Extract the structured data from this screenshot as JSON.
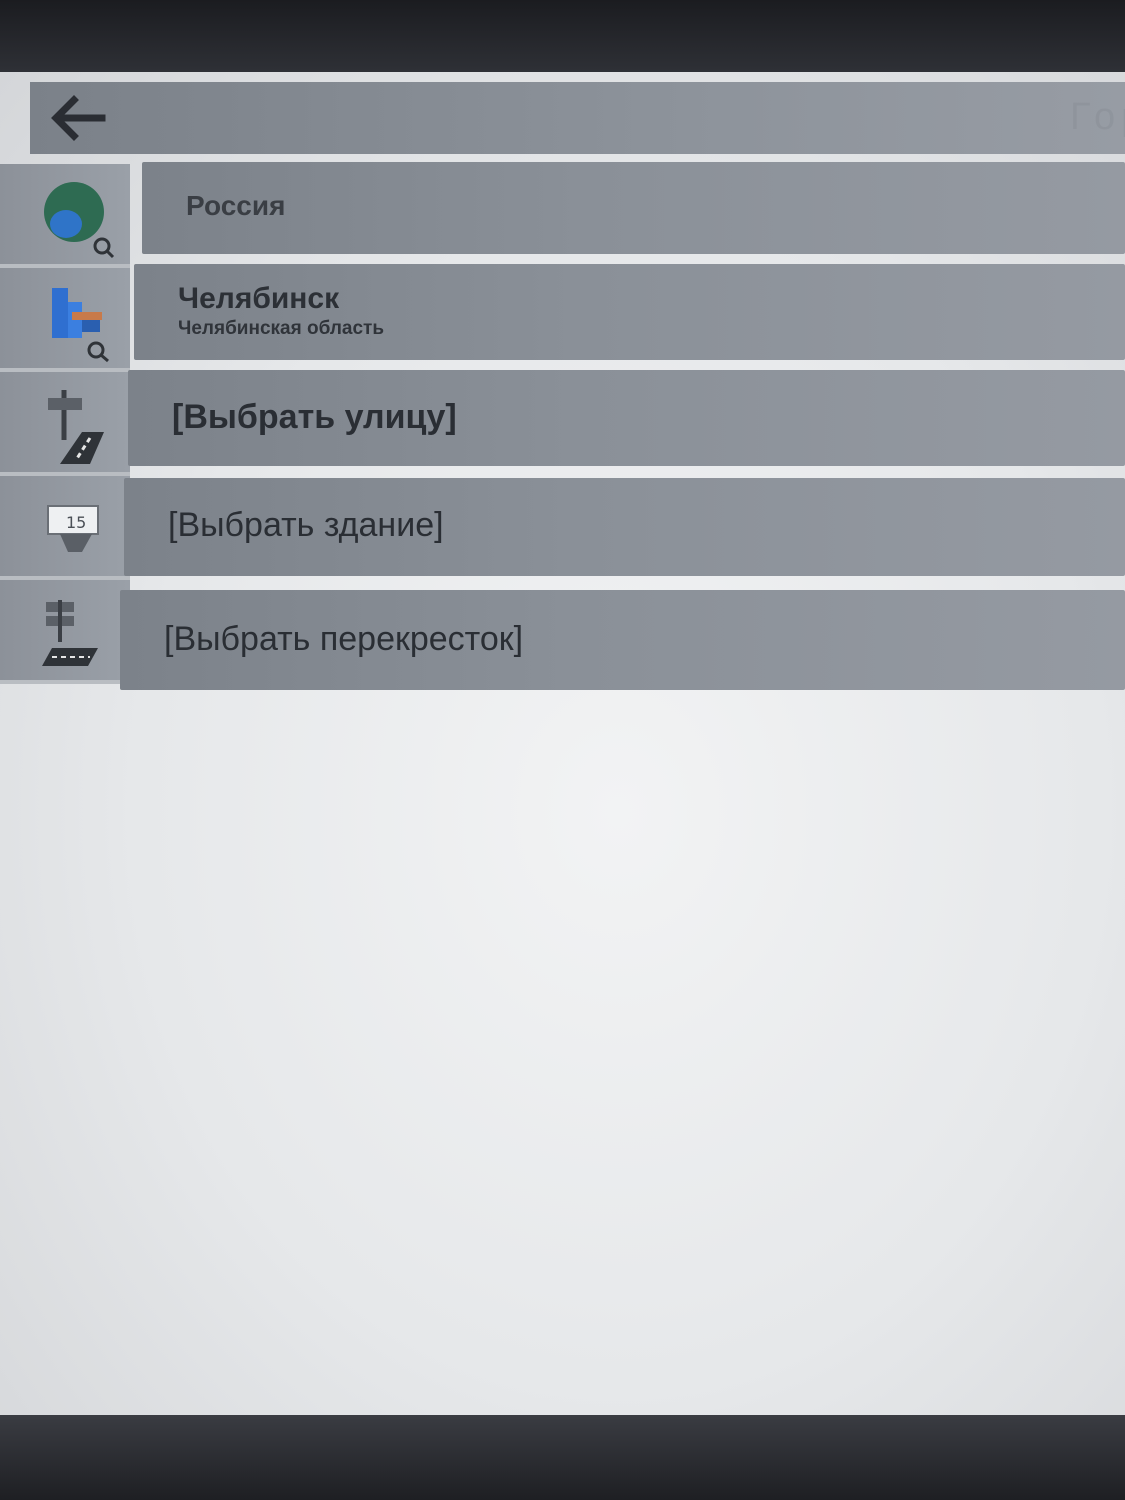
{
  "header": {
    "title": "Гор",
    "back_icon": "arrow-left-icon"
  },
  "rows": [
    {
      "icon": "globe-search-icon",
      "title": "Россия"
    },
    {
      "icon": "city-search-icon",
      "title": "Челябинск",
      "subtitle": "Челябинская область"
    },
    {
      "icon": "street-sign-icon",
      "title": "[Выбрать улицу]"
    },
    {
      "icon": "building-number-icon",
      "title": "[Выбрать здание]"
    },
    {
      "icon": "intersection-icon",
      "title": "[Выбрать перекресток]"
    }
  ],
  "colors": {
    "header_bg": "#8a9098",
    "row_bg": "#8a9098",
    "screen_bg": "#e6e8ea",
    "text": "#2c3036"
  }
}
